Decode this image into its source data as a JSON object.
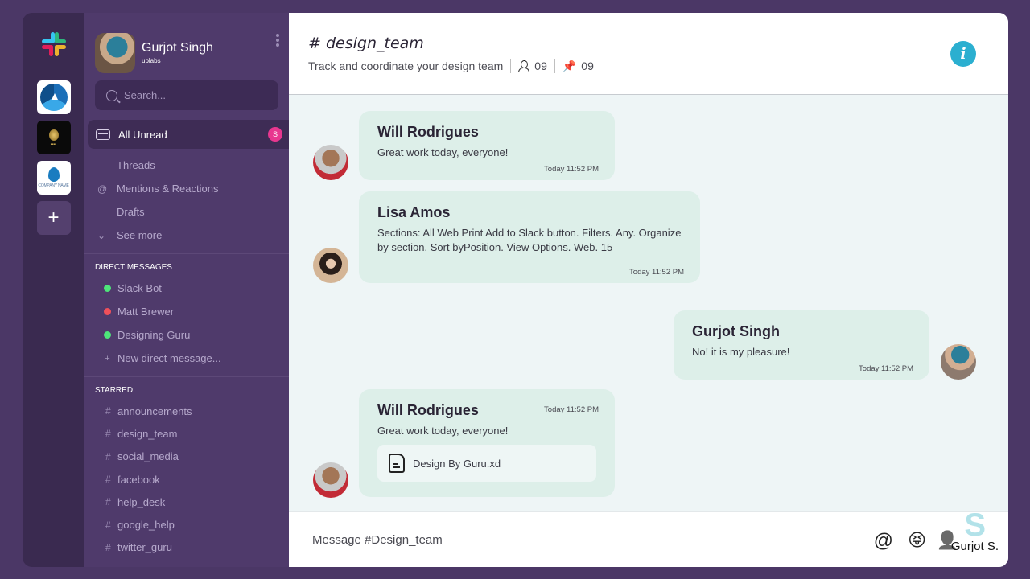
{
  "workspace_rail": {
    "workspaces": [
      {
        "name": "blue-circle-workspace"
      },
      {
        "name": "gold-crest-workspace"
      },
      {
        "name": "company-name-workspace",
        "label": "COMPANY NAME"
      }
    ],
    "add_label": "+"
  },
  "profile": {
    "name": "Gurjot Singh",
    "org": "uplabs"
  },
  "search": {
    "placeholder": "Search..."
  },
  "nav": {
    "all_unread": {
      "label": "All Unread",
      "badge": "S"
    },
    "items": [
      {
        "label": "Threads",
        "icon": ""
      },
      {
        "label": "Mentions & Reactions",
        "icon": "@"
      },
      {
        "label": "Drafts",
        "icon": ""
      },
      {
        "label": "See more",
        "icon": "⌄"
      }
    ]
  },
  "direct_messages": {
    "title": "DIRECT MESSAGES",
    "items": [
      {
        "label": "Slack Bot",
        "status_color": "#4ee57a"
      },
      {
        "label": "Matt Brewer",
        "status_color": "#f0505a"
      },
      {
        "label": "Designing Guru",
        "status_color": "#4ee57a"
      }
    ],
    "new_label": "New direct message..."
  },
  "starred": {
    "title": "STARRED",
    "channels": [
      "announcements",
      "design_team",
      "social_media",
      "facebook",
      "help_desk",
      "google_help",
      "twitter_guru"
    ]
  },
  "header": {
    "title": "# design_team",
    "description": "Track and coordinate your design team",
    "members": "09",
    "pins": "09",
    "info_label": "i"
  },
  "messages": [
    {
      "author": "Will Rodrigues",
      "text": "Great work today, everyone!",
      "time": "Today  11:52 PM"
    },
    {
      "author": "Lisa Amos",
      "text": "Sections: All Web Print Add to Slack button. Filters. Any. Organize by section. Sort byPosition. View Options. Web. 15",
      "time": "Today  11:52 PM"
    },
    {
      "author": "Gurjot Singh",
      "text": "No! it is my pleasure!",
      "time": "Today  11:52 PM"
    },
    {
      "author": "Will Rodrigues",
      "text": "Great work today, everyone!",
      "time": "Today  11:52 PM",
      "attachment": "Design By Guru.xd"
    }
  ],
  "composer": {
    "placeholder": "Message #Design_team",
    "mention_icon": "@",
    "emoji_icon": "😝",
    "user_icon": "👤"
  },
  "watermark": {
    "letter": "S",
    "text": "Gurjot S."
  }
}
